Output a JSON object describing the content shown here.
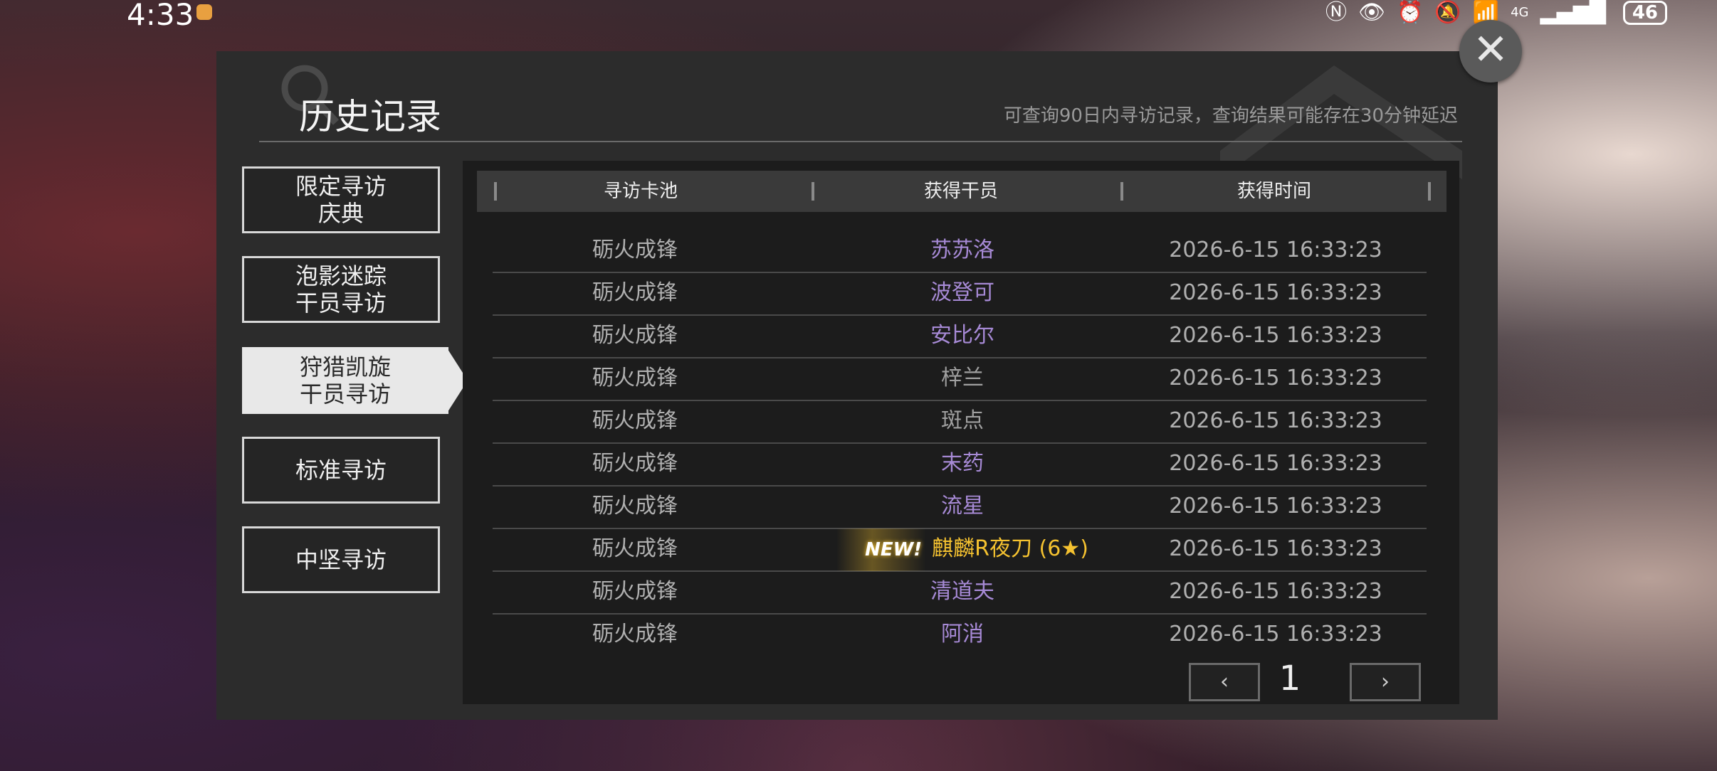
{
  "status_bar": {
    "time": "4:33",
    "network": "4G",
    "battery": "46"
  },
  "dialog": {
    "title": "历史记录",
    "subtitle": "可查询90日内寻访记录，查询结果可能存在30分钟延迟",
    "close_label": "✕"
  },
  "sidebar": {
    "items": [
      {
        "label": "限定寻访\n庆典",
        "active": false
      },
      {
        "label": "泡影迷踪\n干员寻访",
        "active": false
      },
      {
        "label": "狩猎凯旋\n干员寻访",
        "active": true
      },
      {
        "label": "标准寻访",
        "active": false
      },
      {
        "label": "中坚寻访",
        "active": false
      }
    ]
  },
  "table": {
    "columns": [
      "寻访卡池",
      "获得干员",
      "获得时间"
    ],
    "rows": [
      {
        "pool": "砺火成锋",
        "operator": "苏苏洛",
        "rarity": 4,
        "time": "2026-6-15 16:33:23"
      },
      {
        "pool": "砺火成锋",
        "operator": "波登可",
        "rarity": 4,
        "time": "2026-6-15 16:33:23"
      },
      {
        "pool": "砺火成锋",
        "operator": "安比尔",
        "rarity": 4,
        "time": "2026-6-15 16:33:23"
      },
      {
        "pool": "砺火成锋",
        "operator": "梓兰",
        "rarity": 3,
        "time": "2026-6-15 16:33:23"
      },
      {
        "pool": "砺火成锋",
        "operator": "斑点",
        "rarity": 3,
        "time": "2026-6-15 16:33:23"
      },
      {
        "pool": "砺火成锋",
        "operator": "末药",
        "rarity": 4,
        "time": "2026-6-15 16:33:23"
      },
      {
        "pool": "砺火成锋",
        "operator": "流星",
        "rarity": 4,
        "time": "2026-6-15 16:33:23"
      },
      {
        "pool": "砺火成锋",
        "operator": "麒麟R夜刀 (6★)",
        "rarity": 6,
        "new_badge": "NEW!",
        "time": "2026-6-15 16:33:23"
      },
      {
        "pool": "砺火成锋",
        "operator": "清道夫",
        "rarity": 4,
        "time": "2026-6-15 16:33:23"
      },
      {
        "pool": "砺火成锋",
        "operator": "阿消",
        "rarity": 4,
        "time": "2026-6-15 16:33:23"
      }
    ]
  },
  "pagination": {
    "prev_icon": "‹",
    "current_page": "1",
    "next_icon": "›"
  },
  "colors": {
    "rarity_4": "#a78ad6",
    "rarity_3": "#a0a0a0",
    "rarity_6": "#f5c230"
  }
}
